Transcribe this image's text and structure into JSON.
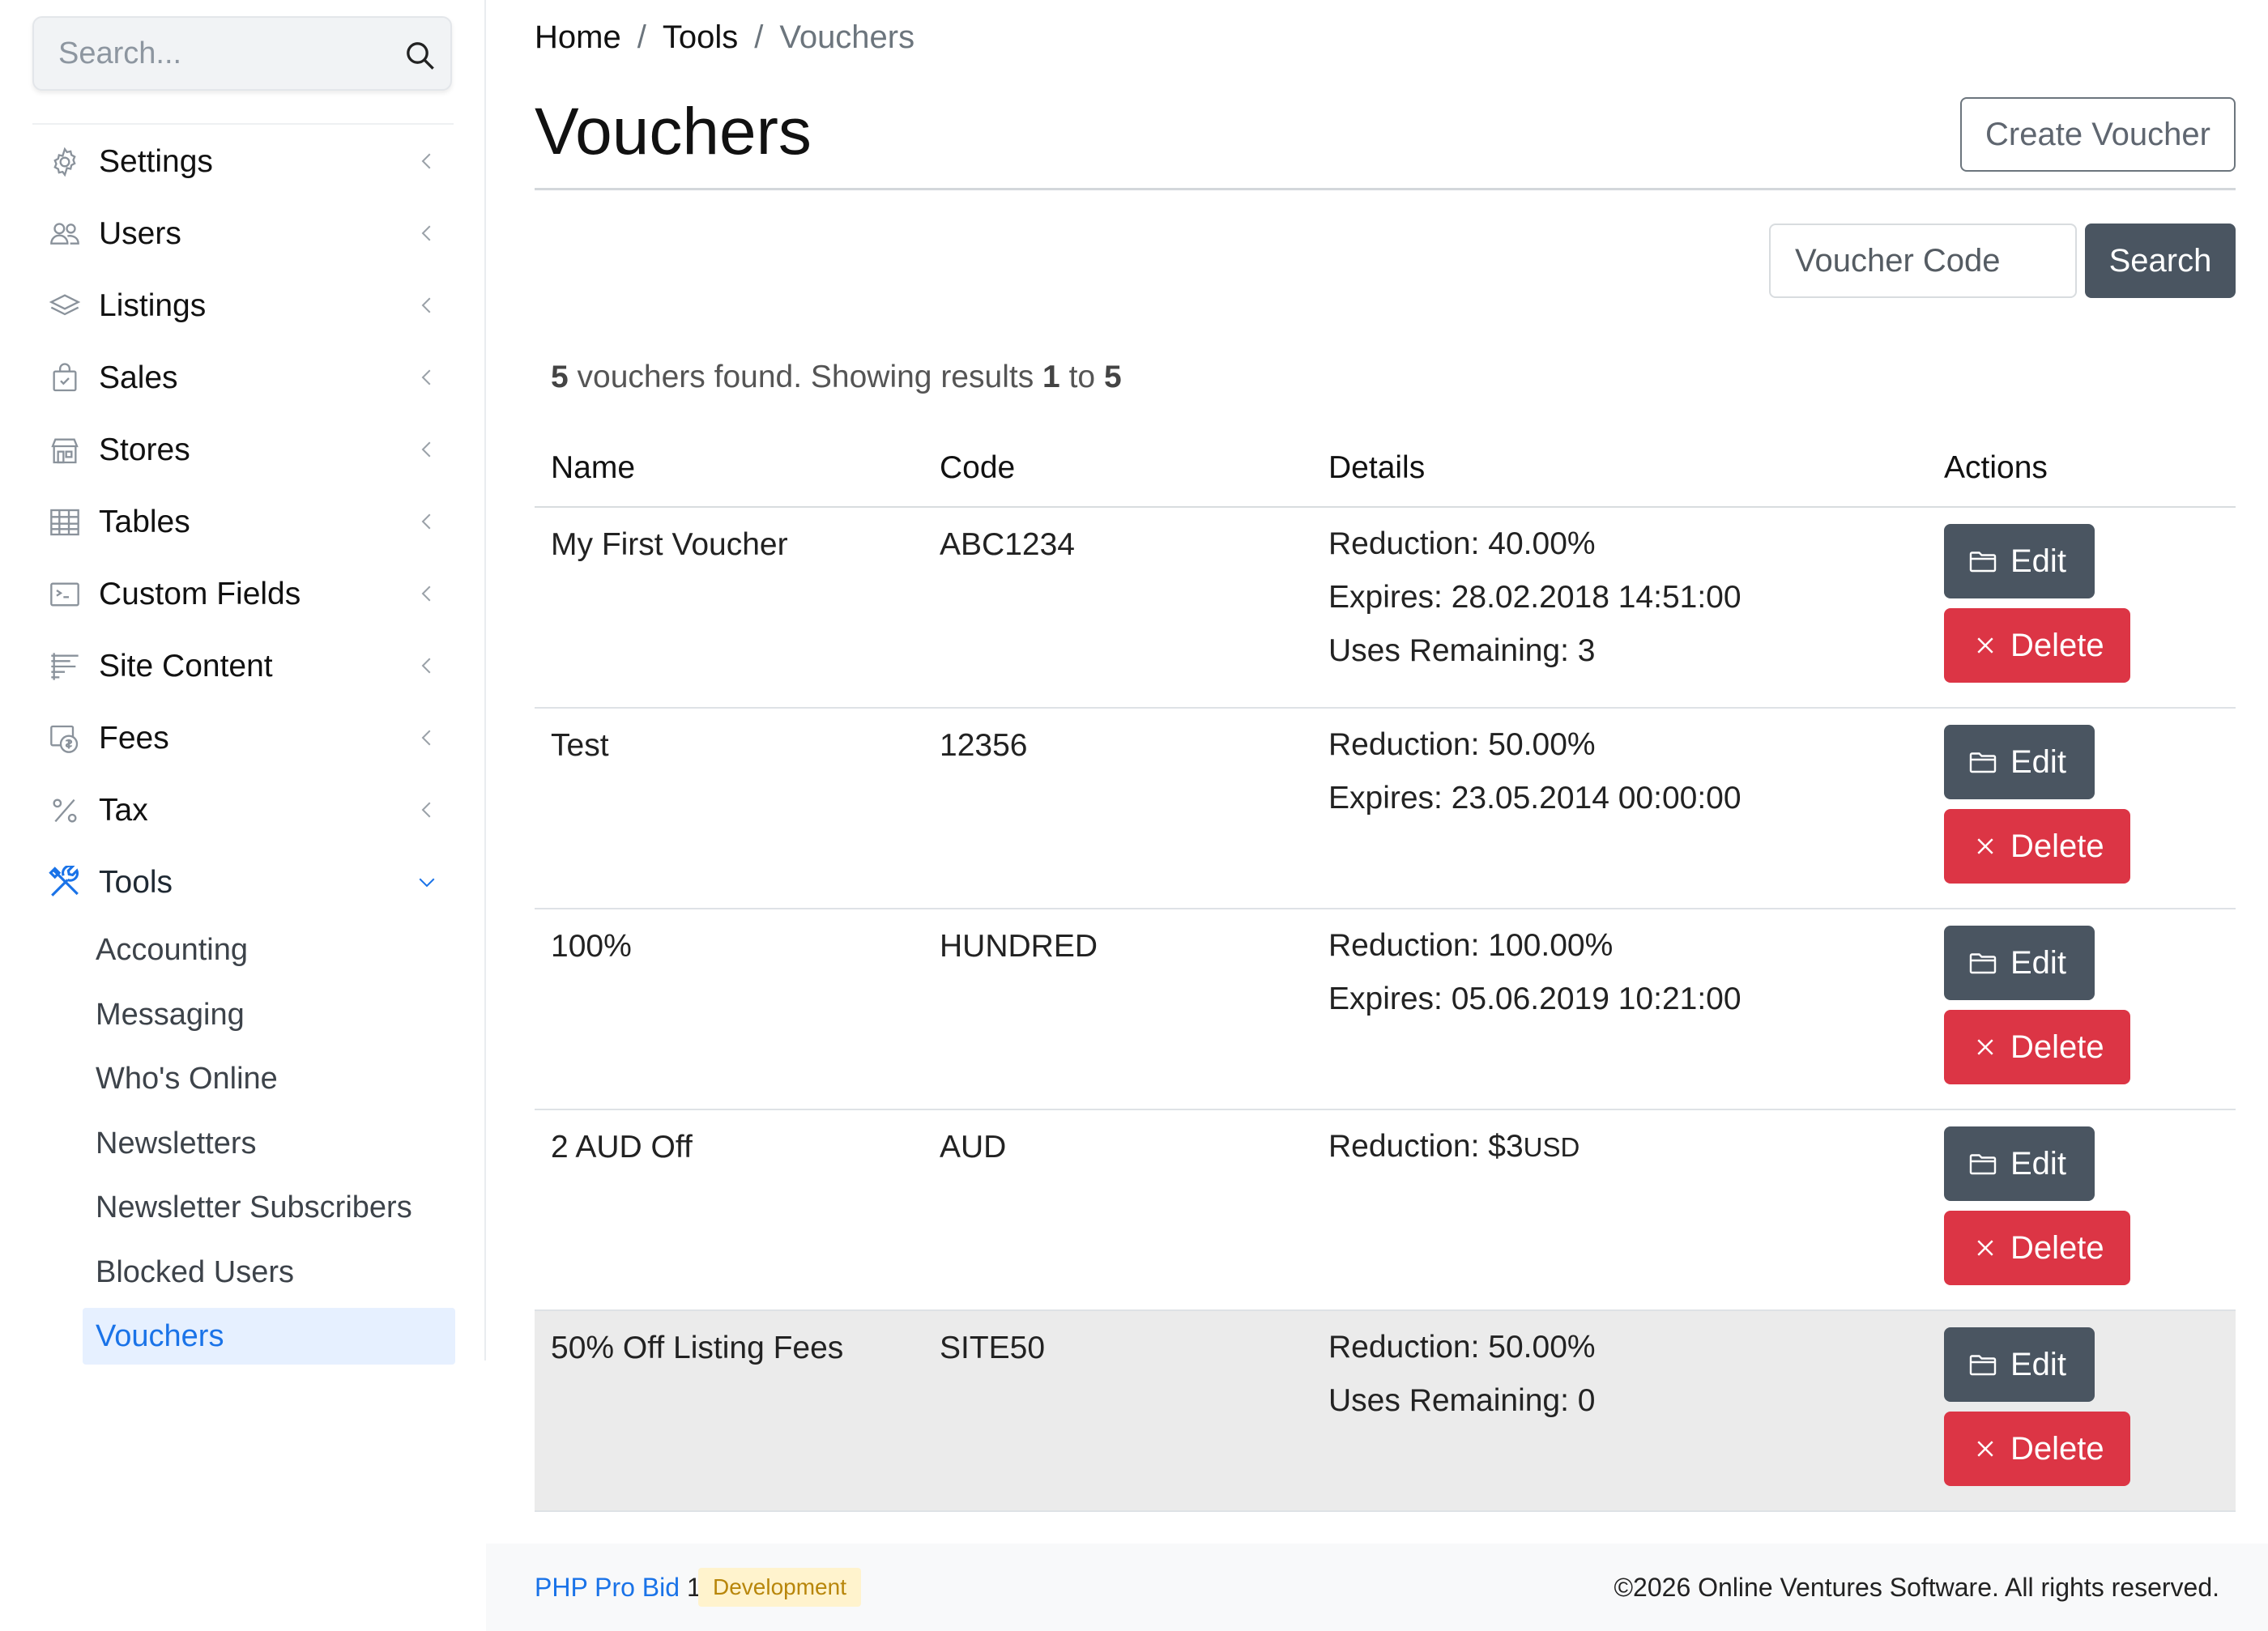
{
  "sidebar": {
    "search_placeholder": "Search...",
    "items": [
      {
        "label": "Settings",
        "icon": "gear-icon"
      },
      {
        "label": "Users",
        "icon": "users-icon"
      },
      {
        "label": "Listings",
        "icon": "layers-icon"
      },
      {
        "label": "Sales",
        "icon": "shopping-bag-icon"
      },
      {
        "label": "Stores",
        "icon": "store-icon"
      },
      {
        "label": "Tables",
        "icon": "table-icon"
      },
      {
        "label": "Custom Fields",
        "icon": "terminal-icon"
      },
      {
        "label": "Site Content",
        "icon": "text-align-icon"
      },
      {
        "label": "Fees",
        "icon": "fees-icon"
      },
      {
        "label": "Tax",
        "icon": "percent-icon"
      },
      {
        "label": "Tools",
        "icon": "tools-icon"
      }
    ],
    "tools_sub": [
      "Accounting",
      "Messaging",
      "Who's Online",
      "Newsletters",
      "Newsletter Subscribers",
      "Blocked Users",
      "Vouchers"
    ],
    "accent_color": "#1a73e8"
  },
  "breadcrumb": {
    "home": "Home",
    "tools": "Tools",
    "current": "Vouchers",
    "separator": "/"
  },
  "page": {
    "title": "Vouchers",
    "create_label": "Create Voucher",
    "code_placeholder": "Voucher Code",
    "search_label": "Search"
  },
  "results": {
    "count": "5",
    "text_mid": " vouchers found. Showing results ",
    "from": "1",
    "to_word": " to ",
    "to": "5"
  },
  "table": {
    "headers": [
      "Name",
      "Code",
      "Details",
      "Actions"
    ],
    "edit_label": "Edit",
    "delete_label": "Delete",
    "rows": [
      {
        "name": "My First Voucher",
        "code": "ABC1234",
        "details": [
          "Reduction:  40.00%",
          "Expires:  28.02.2018 14:51:00",
          "Uses Remaining:  3"
        ]
      },
      {
        "name": "Test",
        "code": "12356",
        "details": [
          "Reduction:  50.00%",
          "Expires:  23.05.2014 00:00:00"
        ]
      },
      {
        "name": "100%",
        "code": "HUNDRED",
        "details": [
          "Reduction:  100.00%",
          "Expires:  05.06.2019 10:21:00"
        ]
      },
      {
        "name": "2 AUD Off",
        "code": "AUD",
        "details": [
          "Reduction:  $3"
        ],
        "unit": "USD"
      },
      {
        "name": "50% Off Listing Fees",
        "code": "SITE50",
        "details": [
          "Reduction:  50.00%",
          "Uses Remaining:  0"
        ]
      }
    ]
  },
  "footer": {
    "brand": "PHP Pro Bid",
    "version": "10.0",
    "badge": "Development",
    "copyright": "©2026 Online Ventures Software. All rights reserved."
  },
  "colors": {
    "dark_button": "#4a5561",
    "danger": "#dc3545",
    "link": "#1a73e8"
  }
}
